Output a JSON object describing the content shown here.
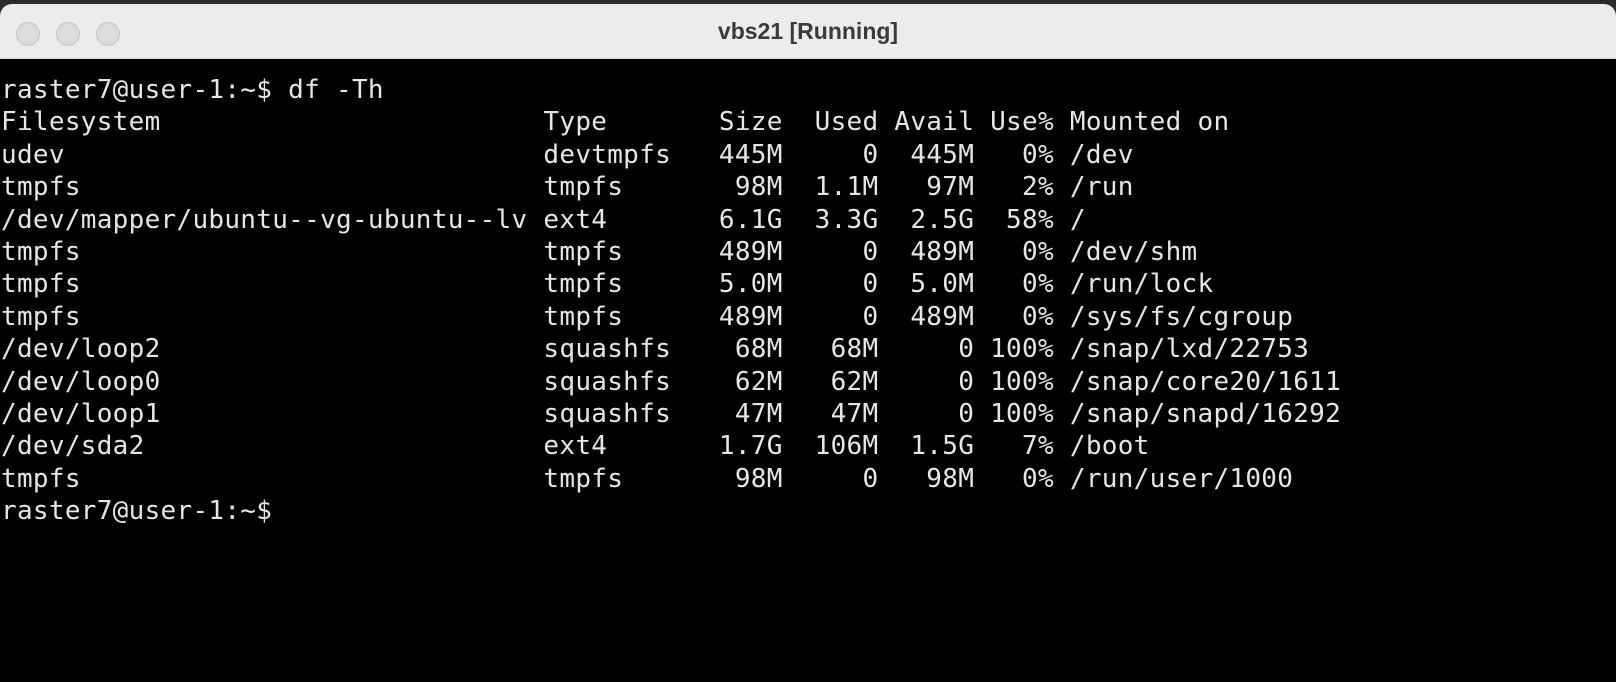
{
  "window": {
    "title": "vbs21 [Running]"
  },
  "terminal": {
    "command_line": "raster7@user-1:~$ df -Th",
    "header": "Filesystem                        Type       Size  Used Avail Use% Mounted on",
    "rows": [
      "udev                              devtmpfs   445M     0  445M   0% /dev",
      "tmpfs                             tmpfs       98M  1.1M   97M   2% /run",
      "/dev/mapper/ubuntu--vg-ubuntu--lv ext4       6.1G  3.3G  2.5G  58% /",
      "tmpfs                             tmpfs      489M     0  489M   0% /dev/shm",
      "tmpfs                             tmpfs      5.0M     0  5.0M   0% /run/lock",
      "tmpfs                             tmpfs      489M     0  489M   0% /sys/fs/cgroup",
      "/dev/loop2                        squashfs    68M   68M     0 100% /snap/lxd/22753",
      "/dev/loop0                        squashfs    62M   62M     0 100% /snap/core20/1611",
      "/dev/loop1                        squashfs    47M   47M     0 100% /snap/snapd/16292",
      "/dev/sda2                         ext4       1.7G  106M  1.5G   7% /boot",
      "tmpfs                             tmpfs       98M     0   98M   0% /run/user/1000"
    ],
    "prompt": "raster7@user-1:~$ "
  }
}
